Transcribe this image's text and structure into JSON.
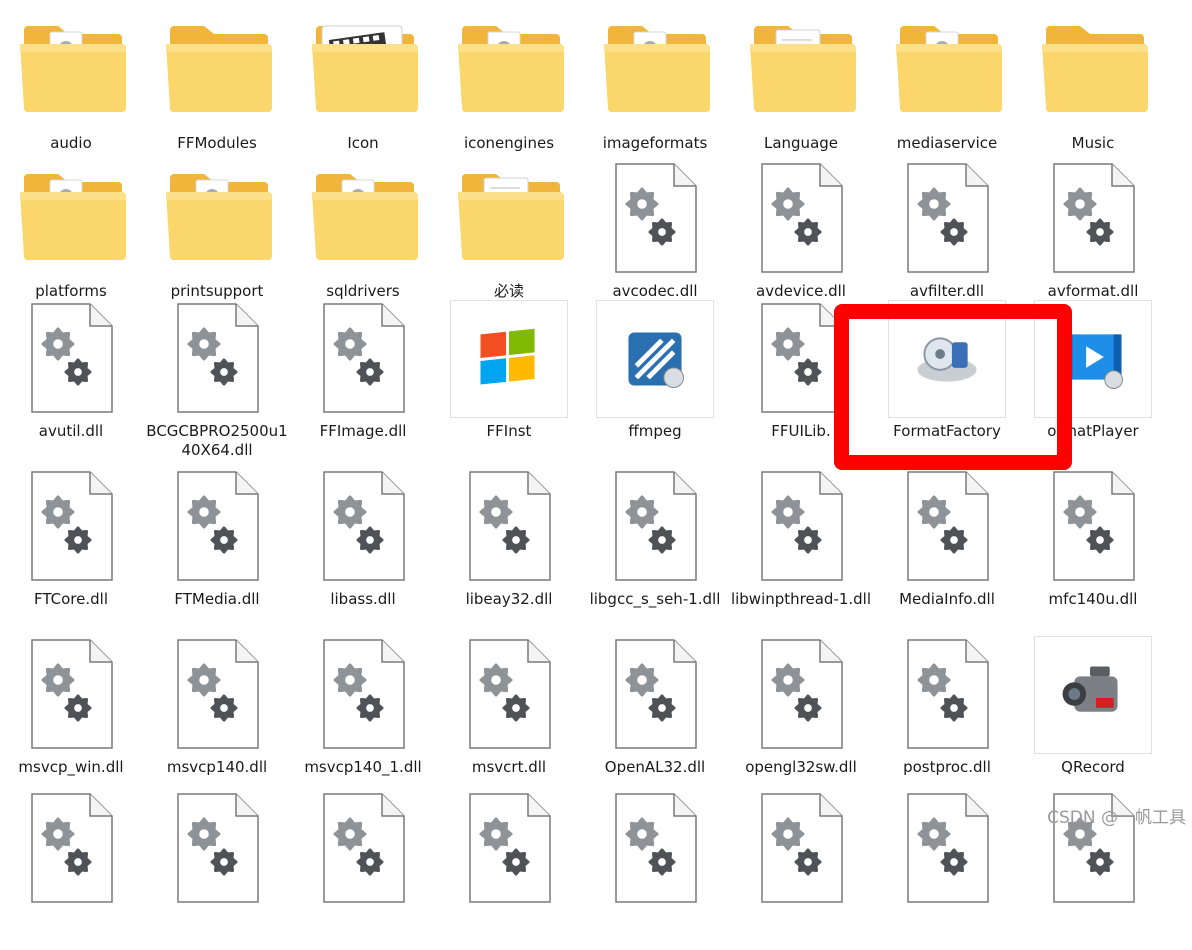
{
  "rows": [
    [
      {
        "label": "audio",
        "icon": "folder-doc-icon"
      },
      {
        "label": "FFModules",
        "icon": "folder-icon"
      },
      {
        "label": "Icon",
        "icon": "folder-film-icon"
      },
      {
        "label": "iconengines",
        "icon": "folder-doc-icon"
      },
      {
        "label": "imageformats",
        "icon": "folder-doc-icon"
      },
      {
        "label": "Language",
        "icon": "folder-page-icon"
      },
      {
        "label": "mediaservice",
        "icon": "folder-doc-icon"
      },
      {
        "label": "Music",
        "icon": "folder-icon"
      }
    ],
    [
      {
        "label": "platforms",
        "icon": "folder-doc-icon"
      },
      {
        "label": "printsupport",
        "icon": "folder-doc-icon"
      },
      {
        "label": "sqldrivers",
        "icon": "folder-doc-icon"
      },
      {
        "label": "必读",
        "icon": "folder-page-icon"
      },
      {
        "label": "avcodec.dll",
        "icon": "dll-icon"
      },
      {
        "label": "avdevice.dll",
        "icon": "dll-icon"
      },
      {
        "label": "avfilter.dll",
        "icon": "dll-icon"
      },
      {
        "label": "avformat.dll",
        "icon": "dll-icon"
      }
    ],
    [
      {
        "label": "avutil.dll",
        "icon": "dll-icon"
      },
      {
        "label": "BCGCBPRO2500u140X64.dll",
        "icon": "dll-icon"
      },
      {
        "label": "FFImage.dll",
        "icon": "dll-icon"
      },
      {
        "label": "FFInst",
        "icon": "windows-logo-icon"
      },
      {
        "label": "ffmpeg",
        "icon": "ffmpeg-app-icon"
      },
      {
        "label": "FFUILib.",
        "icon": "dll-icon"
      },
      {
        "label": "FormatFactory",
        "icon": "formatfactory-app-icon"
      },
      {
        "label": "ormatPlayer",
        "icon": "formatplayer-app-icon"
      }
    ],
    [
      {
        "label": "FTCore.dll",
        "icon": "dll-icon"
      },
      {
        "label": "FTMedia.dll",
        "icon": "dll-icon"
      },
      {
        "label": "libass.dll",
        "icon": "dll-icon"
      },
      {
        "label": "libeay32.dll",
        "icon": "dll-icon"
      },
      {
        "label": "libgcc_s_seh-1.dll",
        "icon": "dll-icon"
      },
      {
        "label": "libwinpthread-1.dll",
        "icon": "dll-icon"
      },
      {
        "label": "MediaInfo.dll",
        "icon": "dll-icon"
      },
      {
        "label": "mfc140u.dll",
        "icon": "dll-icon"
      }
    ],
    [
      {
        "label": "msvcp_win.dll",
        "icon": "dll-icon"
      },
      {
        "label": "msvcp140.dll",
        "icon": "dll-icon"
      },
      {
        "label": "msvcp140_1.dll",
        "icon": "dll-icon"
      },
      {
        "label": "msvcrt.dll",
        "icon": "dll-icon"
      },
      {
        "label": "OpenAL32.dll",
        "icon": "dll-icon"
      },
      {
        "label": "opengl32sw.dll",
        "icon": "dll-icon"
      },
      {
        "label": "postproc.dll",
        "icon": "dll-icon"
      },
      {
        "label": "QRecord",
        "icon": "qrecord-camera-icon"
      }
    ],
    [
      {
        "label": "",
        "icon": "dll-icon"
      },
      {
        "label": "",
        "icon": "dll-icon"
      },
      {
        "label": "",
        "icon": "dll-icon"
      },
      {
        "label": "",
        "icon": "dll-icon"
      },
      {
        "label": "",
        "icon": "dll-icon"
      },
      {
        "label": "",
        "icon": "dll-icon"
      },
      {
        "label": "",
        "icon": "dll-icon"
      },
      {
        "label": "",
        "icon": "dll-icon"
      }
    ]
  ],
  "highlight": {
    "label": "FormatFactory",
    "color": "#ff0000"
  },
  "watermark": "CSDN @一帆工具",
  "colors": {
    "folder": "#f7c94c",
    "folder_front": "#fbd869",
    "gear": "#7d8388"
  }
}
